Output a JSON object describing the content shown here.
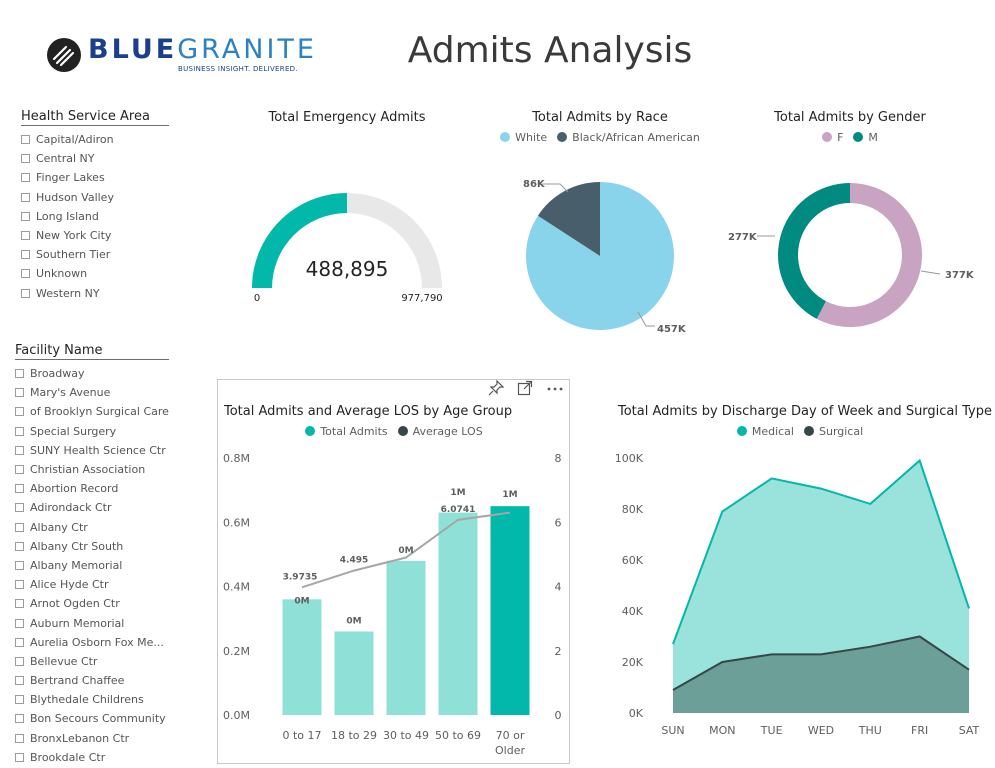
{
  "header": {
    "logo_blue": "BLUE",
    "logo_granite": "GRANITE",
    "logo_tagline": "BUSINESS INSIGHT. DELIVERED.",
    "title": "Admits Analysis"
  },
  "colors": {
    "teal": "#01b8aa",
    "teal_light": "#8fe0d7",
    "dark_teal": "#018a80",
    "dark_slate": "#374649",
    "slate": "#485f6b",
    "sky": "#8ad4eb",
    "pink": "#c9a3c2",
    "gauge_track": "#e8e8e8"
  },
  "slicers": {
    "health_service_area": {
      "title": "Health Service Area",
      "items": [
        "Capital/Adiron",
        "Central NY",
        "Finger Lakes",
        "Hudson Valley",
        "Long Island",
        "New York City",
        "Southern Tier",
        "Unknown",
        "Western NY"
      ]
    },
    "facility_name": {
      "title": "Facility Name",
      "items": [
        "Broadway",
        "Mary's Avenue",
        "of Brooklyn Surgical Care",
        "Special Surgery",
        "SUNY Health Science Ctr",
        "Christian Association",
        "Abortion Record",
        "Adirondack Ctr",
        "Albany Ctr",
        "Albany Ctr South",
        "Albany Memorial",
        "Alice Hyde Ctr",
        "Arnot Ogden Ctr",
        "Auburn Memorial",
        "Aurelia Osborn Fox Me...",
        "Bellevue Ctr",
        "Bertrand Chaffee",
        "Blythedale Childrens",
        "Bon Secours Community",
        "BronxLebanon Ctr",
        "Brookdale Ctr"
      ]
    }
  },
  "gauge": {
    "title": "Total Emergency Admits",
    "value_label": "488,895",
    "min_label": "0",
    "max_label": "977,790",
    "value": 488895,
    "max": 977790
  },
  "race": {
    "title": "Total Admits by Race",
    "legend": [
      {
        "name": "White",
        "color": "#8ad4eb"
      },
      {
        "name": "Black/African American",
        "color": "#485f6b"
      }
    ],
    "label_white": "457K",
    "label_black": "86K"
  },
  "gender": {
    "title": "Total Admits by Gender",
    "legend": [
      {
        "name": "F",
        "color": "#c9a3c2"
      },
      {
        "name": "M",
        "color": "#018a80"
      }
    ],
    "label_f": "377K",
    "label_m": "277K"
  },
  "age_chart": {
    "title": "Total Admits and Average LOS by Age Group",
    "legend_admits": "Total Admits",
    "legend_los": "Average LOS",
    "categories_line1": [
      "0 to 17",
      "18 to 29",
      "30 to 49",
      "50 to 69",
      "70 or"
    ],
    "categories_line2": [
      "",
      "",
      "",
      "",
      "Older"
    ],
    "left_ticks": [
      "0.8M",
      "0.6M",
      "0.4M",
      "0.2M",
      "0.0M"
    ],
    "right_ticks": [
      "8",
      "6",
      "4",
      "2",
      "0"
    ],
    "bar_labels": [
      "0M",
      "0M",
      "0M",
      "1M",
      "1M"
    ],
    "los_labels": [
      "3.9735",
      "4.495",
      "",
      "6.0741",
      ""
    ]
  },
  "day_chart": {
    "title": "Total Admits by Discharge Day of Week and Surgical Type",
    "legend_medical": "Medical",
    "legend_surgical": "Surgical",
    "categories": [
      "SUN",
      "MON",
      "TUE",
      "WED",
      "THU",
      "FRI",
      "SAT"
    ],
    "y_ticks": [
      "100K",
      "80K",
      "60K",
      "40K",
      "20K",
      "0K"
    ]
  },
  "chart_data": [
    {
      "type": "bar",
      "title": "Total Admits and Average LOS by Age Group",
      "categories": [
        "0 to 17",
        "18 to 29",
        "30 to 49",
        "50 to 69",
        "70 or Older"
      ],
      "series": [
        {
          "name": "Total Admits",
          "axis": "left",
          "values": [
            360000,
            260000,
            480000,
            630000,
            650000
          ]
        },
        {
          "name": "Average LOS",
          "axis": "right",
          "type": "line",
          "values": [
            3.9735,
            4.495,
            4.9,
            6.0741,
            6.3
          ]
        }
      ],
      "ylim": [
        0,
        800000
      ],
      "y2lim": [
        0,
        8
      ],
      "grid": false,
      "legend": "top-center"
    },
    {
      "type": "area",
      "title": "Total Admits by Discharge Day of Week and Surgical Type",
      "categories": [
        "SUN",
        "MON",
        "TUE",
        "WED",
        "THU",
        "FRI",
        "SAT"
      ],
      "series": [
        {
          "name": "Medical",
          "values": [
            27000,
            79000,
            92000,
            88000,
            82000,
            99000,
            41000
          ]
        },
        {
          "name": "Surgical",
          "values": [
            9000,
            20000,
            23000,
            23000,
            26000,
            30000,
            17000
          ]
        }
      ],
      "ylim": [
        0,
        100000
      ],
      "grid": false,
      "legend": "top-center"
    },
    {
      "type": "pie",
      "title": "Total Admits by Race",
      "categories": [
        "White",
        "Black/African American"
      ],
      "values": [
        457000,
        86000
      ]
    },
    {
      "type": "pie",
      "title": "Total Admits by Gender",
      "categories": [
        "F",
        "M"
      ],
      "values": [
        377000,
        277000
      ],
      "donut": true
    }
  ]
}
